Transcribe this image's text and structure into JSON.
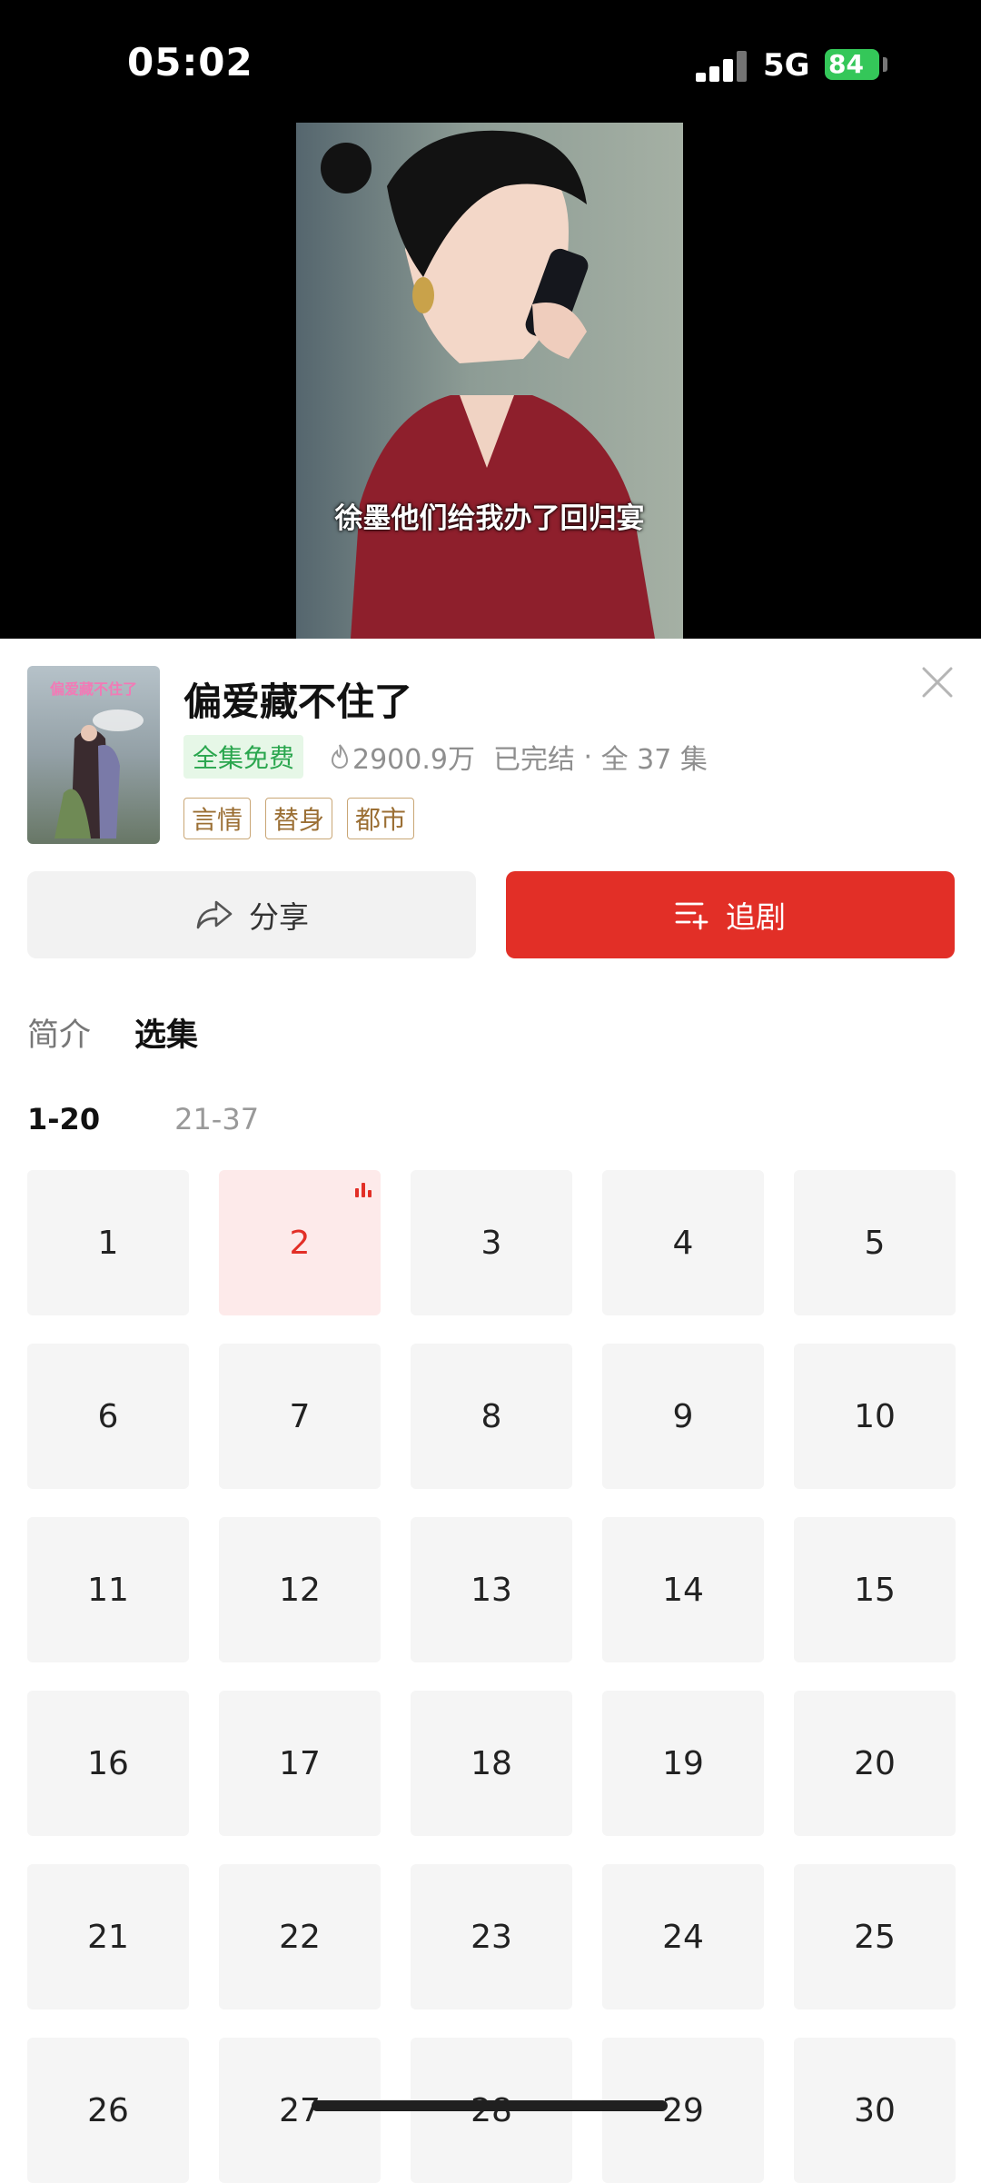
{
  "status_bar": {
    "time": "05:02",
    "network": "5G",
    "battery": "84"
  },
  "video": {
    "subtitle": "徐墨他们给我办了回归宴"
  },
  "poster": {
    "title": "偏爱藏不住了"
  },
  "drama": {
    "title": "偏爱藏不住了",
    "free_badge": "全集免费",
    "views": "2900.9万",
    "status": "已完结",
    "separator": " · ",
    "episodes_total": "全 37 集",
    "tags": [
      "言情",
      "替身",
      "都市"
    ]
  },
  "actions": {
    "share_label": "分享",
    "follow_label": "追剧"
  },
  "tabs": {
    "intro": "简介",
    "episodes": "选集"
  },
  "ranges": [
    "1-20",
    "21-37"
  ],
  "episodes": [
    "1",
    "2",
    "3",
    "4",
    "5",
    "6",
    "7",
    "8",
    "9",
    "10",
    "11",
    "12",
    "13",
    "14",
    "15",
    "16",
    "17",
    "18",
    "19",
    "20",
    "21",
    "22",
    "23",
    "24",
    "25",
    "26",
    "27",
    "28",
    "29",
    "30"
  ],
  "current_episode": "2",
  "colors": {
    "accent": "#e22f27",
    "free_green": "#2aa64e",
    "tag_brown": "#9b6f34"
  }
}
